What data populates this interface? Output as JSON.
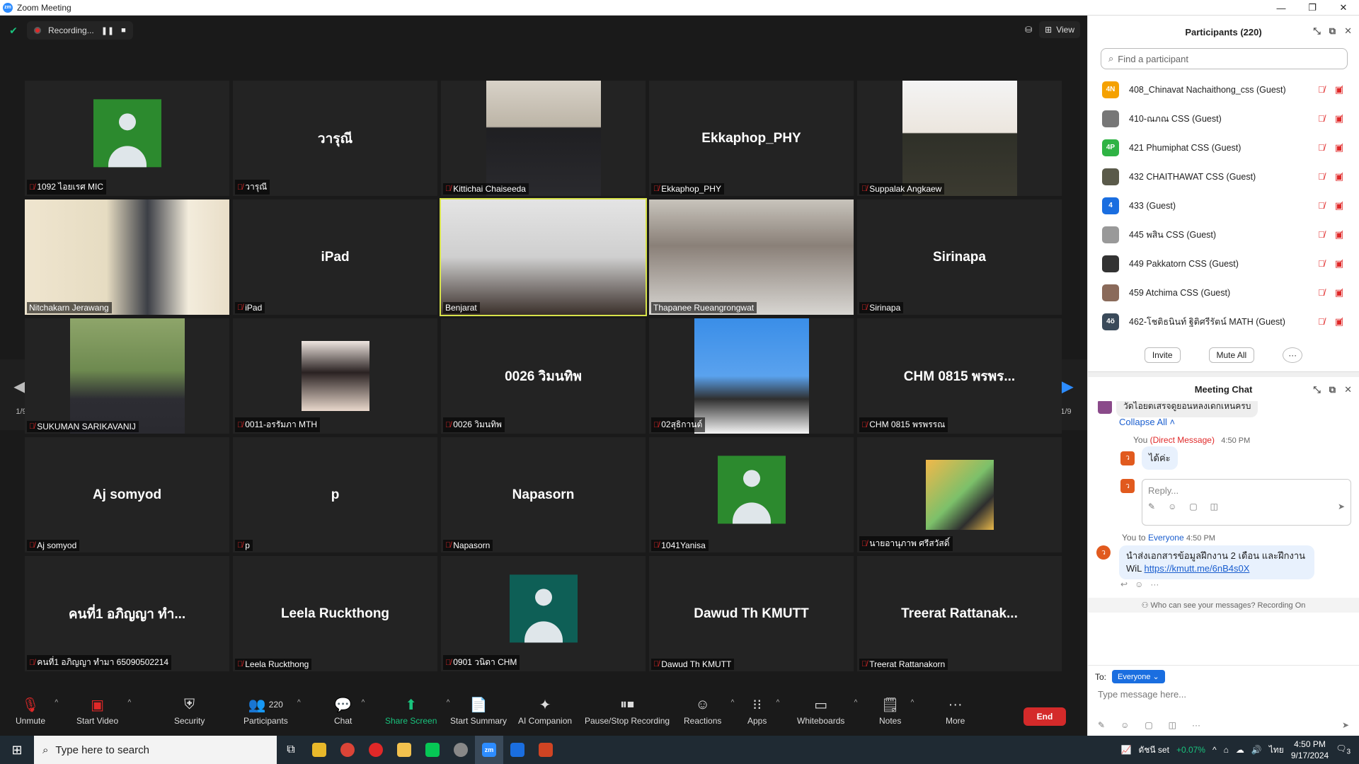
{
  "window": {
    "title": "Zoom Meeting",
    "logo": "zm"
  },
  "top": {
    "recording_label": "Recording...",
    "view_label": "View"
  },
  "nav": {
    "page_left": "1/9",
    "page_right": "1/9"
  },
  "tiles": [
    {
      "big": "",
      "label": "1092 ไอยเรศ MIC",
      "avatar": "green",
      "mic": "off"
    },
    {
      "big": "วารุณี",
      "label": "วารุณี",
      "mic": "off"
    },
    {
      "big": "",
      "label": "Kittichai Chaiseeda",
      "photo": "suit-office",
      "mic": "off"
    },
    {
      "big": "Ekkaphop_PHY",
      "label": "Ekkaphop_PHY",
      "mic": "off"
    },
    {
      "big": "",
      "label": "Suppalak Angkaew",
      "photo": "suit-portrait",
      "mic": "off"
    },
    {
      "big": "",
      "label": "Nitchakarn Jerawang",
      "photo": "video-poster",
      "mic": "on"
    },
    {
      "big": "iPad",
      "label": "iPad",
      "mic": "off"
    },
    {
      "big": "",
      "label": "Benjarat",
      "photo": "video-face",
      "mic": "on",
      "active": true
    },
    {
      "big": "",
      "label": "Thapanee Rueangrongwat",
      "photo": "video-reading",
      "mic": "on"
    },
    {
      "big": "Sirinapa",
      "label": "Sirinapa",
      "mic": "off"
    },
    {
      "big": "",
      "label": "SUKUMAN SARIKAVANIJ",
      "photo": "woman-trees",
      "mic": "off"
    },
    {
      "big": "",
      "label": "0011-อรรัมภา MTH",
      "photo": "anime",
      "mic": "off"
    },
    {
      "big": "0026 วิมนทิพ",
      "label": "0026 วิมนทิพ",
      "mic": "off"
    },
    {
      "big": "",
      "label": "02สุธิกานต์",
      "photo": "cow",
      "mic": "off"
    },
    {
      "big": "CHM 0815 พรพร...",
      "label": "CHM 0815 พรพรรณ",
      "mic": "off"
    },
    {
      "big": "Aj somyod",
      "label": "Aj somyod",
      "mic": "off"
    },
    {
      "big": "p",
      "label": "p",
      "mic": "off"
    },
    {
      "big": "Napasorn",
      "label": "Napasorn",
      "mic": "off"
    },
    {
      "big": "",
      "label": "1041Yanisa",
      "avatar": "green",
      "mic": "off"
    },
    {
      "big": "",
      "label": "นายอานุภาพ ศรีสวัสดิ์",
      "photo": "salamander",
      "mic": "off"
    },
    {
      "big": "คนที่1 อภิญญา ทำ...",
      "label": "คนที่1 อภิญญา ทำมา 65090502214",
      "mic": "off"
    },
    {
      "big": "Leela Ruckthong",
      "label": "Leela Ruckthong",
      "mic": "off"
    },
    {
      "big": "",
      "label": "0901 วนิดา CHM",
      "avatar": "teal",
      "mic": "off"
    },
    {
      "big": "Dawud Th KMUTT",
      "label": "Dawud Th KMUTT",
      "mic": "off"
    },
    {
      "big": "Treerat Rattanak...",
      "label": "Treerat Rattanakorn",
      "mic": "off"
    }
  ],
  "toolbar": {
    "unmute": "Unmute",
    "start_video": "Start Video",
    "security": "Security",
    "participants": "Participants",
    "participants_count": "220",
    "chat": "Chat",
    "share": "Share Screen",
    "summary": "Start Summary",
    "ai": "AI Companion",
    "record": "Pause/Stop Recording",
    "reactions": "Reactions",
    "apps": "Apps",
    "whiteboards": "Whiteboards",
    "notes": "Notes",
    "more": "More",
    "end": "End"
  },
  "participants_panel": {
    "title": "Participants (220)",
    "search_placeholder": "Find a participant",
    "invite": "Invite",
    "mute_all": "Mute All",
    "more": "···",
    "list": [
      {
        "av": "4N",
        "color": "#f5a100",
        "name": "408_Chinavat Nachaithong_css (Guest)"
      },
      {
        "av": "",
        "color": "#777777",
        "name": "410-ณภณ CSS (Guest)"
      },
      {
        "av": "4P",
        "color": "#2fb344",
        "name": "421 Phumiphat CSS (Guest)"
      },
      {
        "av": "",
        "color": "#5a5a4a",
        "name": "432 CHAITHAWAT CSS (Guest)"
      },
      {
        "av": "4",
        "color": "#1a6ee0",
        "name": "433 (Guest)"
      },
      {
        "av": "",
        "color": "#999999",
        "name": "445 พสิน CSS (Guest)"
      },
      {
        "av": "",
        "color": "#333333",
        "name": "449 Pakkatorn CSS (Guest)"
      },
      {
        "av": "",
        "color": "#8a6a5a",
        "name": "459 Atchima CSS (Guest)"
      },
      {
        "av": "4ö",
        "color": "#3a4a5a",
        "name": "462-โชติธนินท์ ฐิติศรีรัตน์ MATH (Guest)"
      }
    ]
  },
  "chat": {
    "title": "Meeting Chat",
    "truncated_msg": "วัดไอยตเสรจดูยอนหลงเดกเหนครบ",
    "collapse": "Collapse All",
    "dm_from": "You",
    "dm_tag": "(Direct Message)",
    "dm_time": "4:50 PM",
    "dm_text": "ได้ค่ะ",
    "reply_placeholder": "Reply...",
    "msg_from": "You to",
    "msg_to": "Everyone",
    "msg_time": "4:50 PM",
    "msg_text": "นำส่งเอกสารข้อมูลฝึกงาน 2 เดือน และฝึกงาน",
    "msg_text2": "WiL",
    "msg_link": "https://kmutt.me/6nB4s0X",
    "privacy": "Who can see your messages? Recording On",
    "to_label": "To:",
    "to_value": "Everyone",
    "input_placeholder": "Type message here...",
    "avatar_char": "ว"
  },
  "taskbar": {
    "search_placeholder": "Type here to search",
    "stock_name": "ดัชนี set",
    "stock_change": "+0.07%",
    "lang": "ไทย",
    "time": "4:50 PM",
    "date": "9/17/2024",
    "notif_count": "3"
  }
}
